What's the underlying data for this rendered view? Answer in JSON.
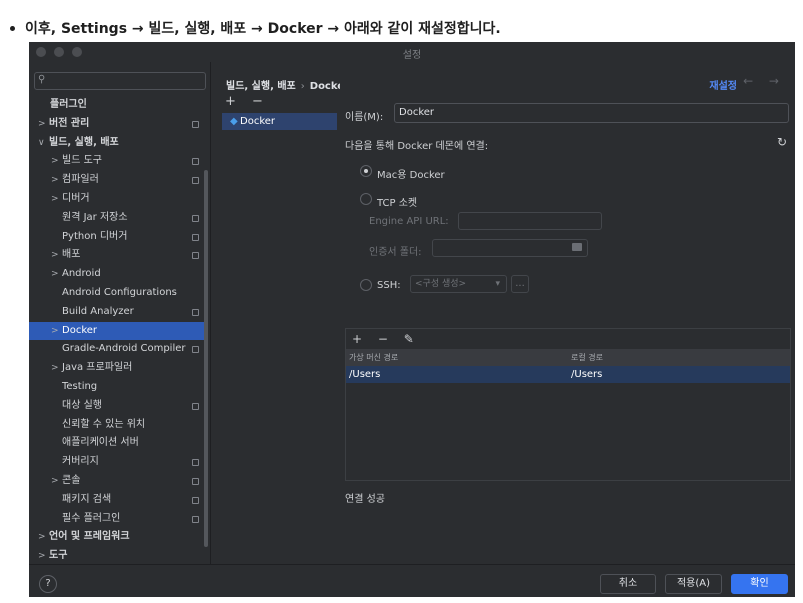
{
  "intro": {
    "text": "이후, Settings → 빌드, 실행, 배포 → Docker → 아래와 같이 재설정합니다."
  },
  "window": {
    "title": "설정"
  },
  "search": {
    "icon": "search-icon"
  },
  "sidebar": {
    "items": [
      {
        "label": "플러그인",
        "arrow": "",
        "indent": 0,
        "bold": true,
        "page": false
      },
      {
        "label": "버전 관리",
        "arrow": ">",
        "indent": 0,
        "bold": true,
        "page": true
      },
      {
        "label": "빌드, 실행, 배포",
        "arrow": "∨",
        "indent": 0,
        "bold": true,
        "page": false
      },
      {
        "label": "빌드 도구",
        "arrow": ">",
        "indent": 1,
        "bold": false,
        "page": true
      },
      {
        "label": "컴파일러",
        "arrow": ">",
        "indent": 1,
        "bold": false,
        "page": true
      },
      {
        "label": "디버거",
        "arrow": ">",
        "indent": 1,
        "bold": false,
        "page": false
      },
      {
        "label": "원격 Jar 저장소",
        "arrow": "",
        "indent": 1,
        "bold": false,
        "page": true
      },
      {
        "label": "Python 디버거",
        "arrow": "",
        "indent": 1,
        "bold": false,
        "page": true
      },
      {
        "label": "배포",
        "arrow": ">",
        "indent": 1,
        "bold": false,
        "page": true
      },
      {
        "label": "Android",
        "arrow": ">",
        "indent": 1,
        "bold": false,
        "page": false
      },
      {
        "label": "Android Configurations",
        "arrow": "",
        "indent": 1,
        "bold": false,
        "page": false
      },
      {
        "label": "Build Analyzer",
        "arrow": "",
        "indent": 1,
        "bold": false,
        "page": true
      },
      {
        "label": "Docker",
        "arrow": ">",
        "indent": 1,
        "bold": false,
        "page": false,
        "selected": true
      },
      {
        "label": "Gradle-Android Compiler",
        "arrow": "",
        "indent": 1,
        "bold": false,
        "page": true
      },
      {
        "label": "Java 프로파일러",
        "arrow": ">",
        "indent": 1,
        "bold": false,
        "page": false
      },
      {
        "label": "Testing",
        "arrow": "",
        "indent": 1,
        "bold": false,
        "page": false
      },
      {
        "label": "대상 실행",
        "arrow": "",
        "indent": 1,
        "bold": false,
        "page": true
      },
      {
        "label": "신뢰할 수 있는 위치",
        "arrow": "",
        "indent": 1,
        "bold": false,
        "page": false
      },
      {
        "label": "애플리케이션 서버",
        "arrow": "",
        "indent": 1,
        "bold": false,
        "page": false
      },
      {
        "label": "커버리지",
        "arrow": "",
        "indent": 1,
        "bold": false,
        "page": true
      },
      {
        "label": "콘솔",
        "arrow": ">",
        "indent": 1,
        "bold": false,
        "page": true
      },
      {
        "label": "패키지 검색",
        "arrow": "",
        "indent": 1,
        "bold": false,
        "page": true
      },
      {
        "label": "필수 플러그인",
        "arrow": "",
        "indent": 1,
        "bold": false,
        "page": true
      },
      {
        "label": "언어 및 프레임워크",
        "arrow": ">",
        "indent": 0,
        "bold": true,
        "page": false
      },
      {
        "label": "도구",
        "arrow": ">",
        "indent": 0,
        "bold": true,
        "page": false
      }
    ]
  },
  "breadcrumb": {
    "parent": "빌드, 실행, 배포",
    "sep": "›",
    "current": "Docker"
  },
  "mid": {
    "tools": "+ −",
    "selected": "Docker",
    "icon": "docker-icon"
  },
  "header": {
    "reset": "재설정",
    "arrows": "← →"
  },
  "form": {
    "name_label": "이름(M):",
    "name_value": "Docker",
    "connect_label": "다음을 통해 Docker 데몬에 연결:",
    "refresh_icon": "↻",
    "mac_label": "Mac용 Docker",
    "tcp_label": "TCP 소켓",
    "api_url_label": "Engine API URL:",
    "cert_label": "인증서 폴더:",
    "ssh_label": "SSH:",
    "ssh_placeholder": "<구성 생성>",
    "ssh_chevron": "▾",
    "ssh_more": "..."
  },
  "volumes": {
    "tools": "+ − ✎",
    "headers": [
      "가상 머신 경로",
      "로컬 경로"
    ],
    "row": [
      "/Users",
      "/Users"
    ]
  },
  "status": "연결 성공",
  "footer": {
    "help": "?",
    "cancel": "취소",
    "apply": "적용(A)",
    "ok": "확인"
  }
}
